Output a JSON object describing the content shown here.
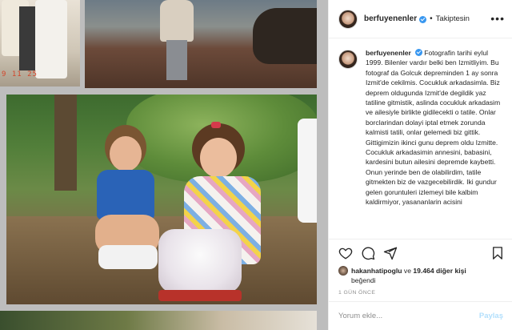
{
  "post": {
    "author": "berfuyenenler",
    "follow_status": "Takiptesin",
    "separator": "•",
    "photo_stamp": "9 11 25"
  },
  "caption": {
    "username": "berfuyenenler",
    "text": "Fotografin tarihi eylul 1999. Bilenler vardır belki ben Izmitliyim. Bu fotograf da Golcuk depreminden 1 ay sonra Izmit'de cekilmis. Cocukluk arkadasimla. Biz deprem oldugunda Izmit'de degildik yaz tatiline gitmistik, aslinda cocukluk arkadasim ve ailesiyle birlikte gidilecekti o tatile. Onlar borclarindan dolayi iptal etmek zorunda kalmisti tatili, onlar gelemedi biz gittik. Gittigimizin ikinci gunu deprem oldu Izmitte. Cocukluk arkadasimin annesini, babasini, kardesini butun ailesini depremde kaybetti. Onun yerinde ben de olabilirdim, tatile gitmekten biz de vazgecebilirdik. Iki gundur gelen goruntuleri izlemeyi bile kalbim kaldirmiyor, yasananlarin acisini"
  },
  "likes": {
    "liker": "hakanhatipoglu",
    "connector": "ve",
    "count": "19.464 diğer kişi",
    "suffix": "beğendi"
  },
  "timestamp": "1 GÜN ÖNCE",
  "comment_input": {
    "placeholder": "Yorum ekle...",
    "post_label": "Paylaş"
  },
  "icons": {
    "like": "heart-icon",
    "comment": "comment-icon",
    "share": "share-icon",
    "save": "bookmark-icon",
    "more": "more-icon",
    "verified": "verified-icon"
  },
  "colors": {
    "verified_blue": "#3897f0",
    "post_button_disabled": "#b2dffc",
    "muted_text": "#8e8e8e"
  }
}
